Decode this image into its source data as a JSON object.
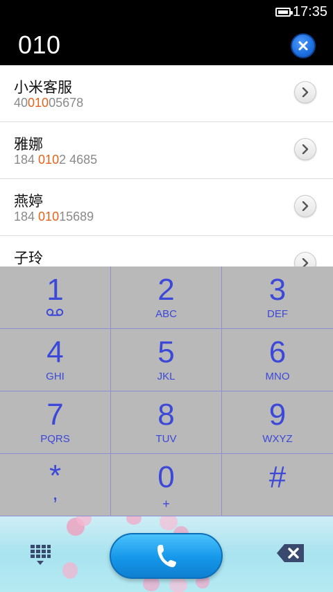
{
  "status_bar": {
    "time": "17:35",
    "battery_level": 1.0
  },
  "dial_input": {
    "number": "010"
  },
  "contacts": [
    {
      "name": "小米客服",
      "phone_before": "40",
      "phone_match": "010",
      "phone_after": "05678"
    },
    {
      "name": "雅娜",
      "phone_before": "184 ",
      "phone_match": "010",
      "phone_after": "2 4685"
    },
    {
      "name": "燕婷",
      "phone_before": "184 ",
      "phone_match": "010",
      "phone_after": "15689"
    },
    {
      "name": "子玲",
      "phone_before": "",
      "phone_match": "",
      "phone_after": ""
    }
  ],
  "keypad": {
    "keys": [
      {
        "digit": "1",
        "letters": ""
      },
      {
        "digit": "2",
        "letters": "ABC"
      },
      {
        "digit": "3",
        "letters": "DEF"
      },
      {
        "digit": "4",
        "letters": "GHI"
      },
      {
        "digit": "5",
        "letters": "JKL"
      },
      {
        "digit": "6",
        "letters": "MNO"
      },
      {
        "digit": "7",
        "letters": "PQRS"
      },
      {
        "digit": "8",
        "letters": "TUV"
      },
      {
        "digit": "9",
        "letters": "WXYZ"
      },
      {
        "digit": "*",
        "letters": ","
      },
      {
        "digit": "0",
        "letters": "+"
      },
      {
        "digit": "#",
        "letters": ""
      }
    ]
  },
  "colors": {
    "accent_blue": "#3b48d8",
    "match_highlight": "#e8611a",
    "call_button": "#1597ea",
    "keypad_bg": "#b9b9b9"
  },
  "icons": {
    "clear": "close-circle-icon",
    "contact_detail": "chevron-right-icon",
    "voicemail": "voicemail-icon",
    "dialpad_toggle": "dialpad-icon",
    "call": "phone-icon",
    "backspace": "backspace-icon"
  }
}
